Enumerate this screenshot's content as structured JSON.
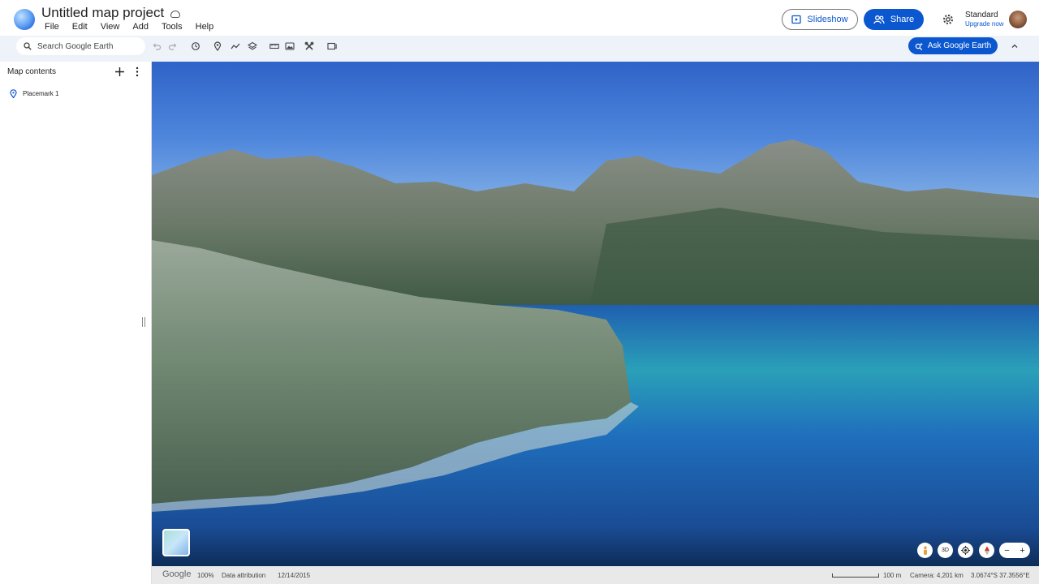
{
  "app": {
    "title": "Untitled map project",
    "menu": [
      "File",
      "Edit",
      "View",
      "Add",
      "Tools",
      "Help"
    ]
  },
  "header": {
    "slideshow_label": "Slideshow",
    "share_label": "Share",
    "plan_label": "Standard",
    "upgrade_label": "Upgrade now"
  },
  "toolbar": {
    "search_placeholder": "Search Google Earth",
    "ask_label": "Ask Google Earth",
    "icons": [
      "undo-icon",
      "redo-icon",
      "history-icon",
      "placemark-icon",
      "path-icon",
      "layers-icon",
      "measure-icon",
      "image-overlay-icon",
      "tools-icon",
      "capture-icon"
    ]
  },
  "sidebar": {
    "title": "Map contents",
    "items": [
      {
        "label": "Placemark 1"
      }
    ]
  },
  "map": {
    "controls": [
      "pegman-icon",
      "3D",
      "recenter-icon",
      "compass-icon"
    ],
    "zoom_out": "−",
    "zoom_in": "+"
  },
  "status": {
    "brand": "Google",
    "zoom": "100%",
    "attribution": "Data attribution",
    "date": "12/14/2015",
    "scale": "100 m",
    "camera": "Camera: 4,201 km",
    "coords": "3.0674°S 37.3556°E"
  },
  "colors": {
    "accent": "#0b57d0",
    "toolbar_bg": "#eef2f9",
    "status_bg": "#e9e9e9"
  }
}
